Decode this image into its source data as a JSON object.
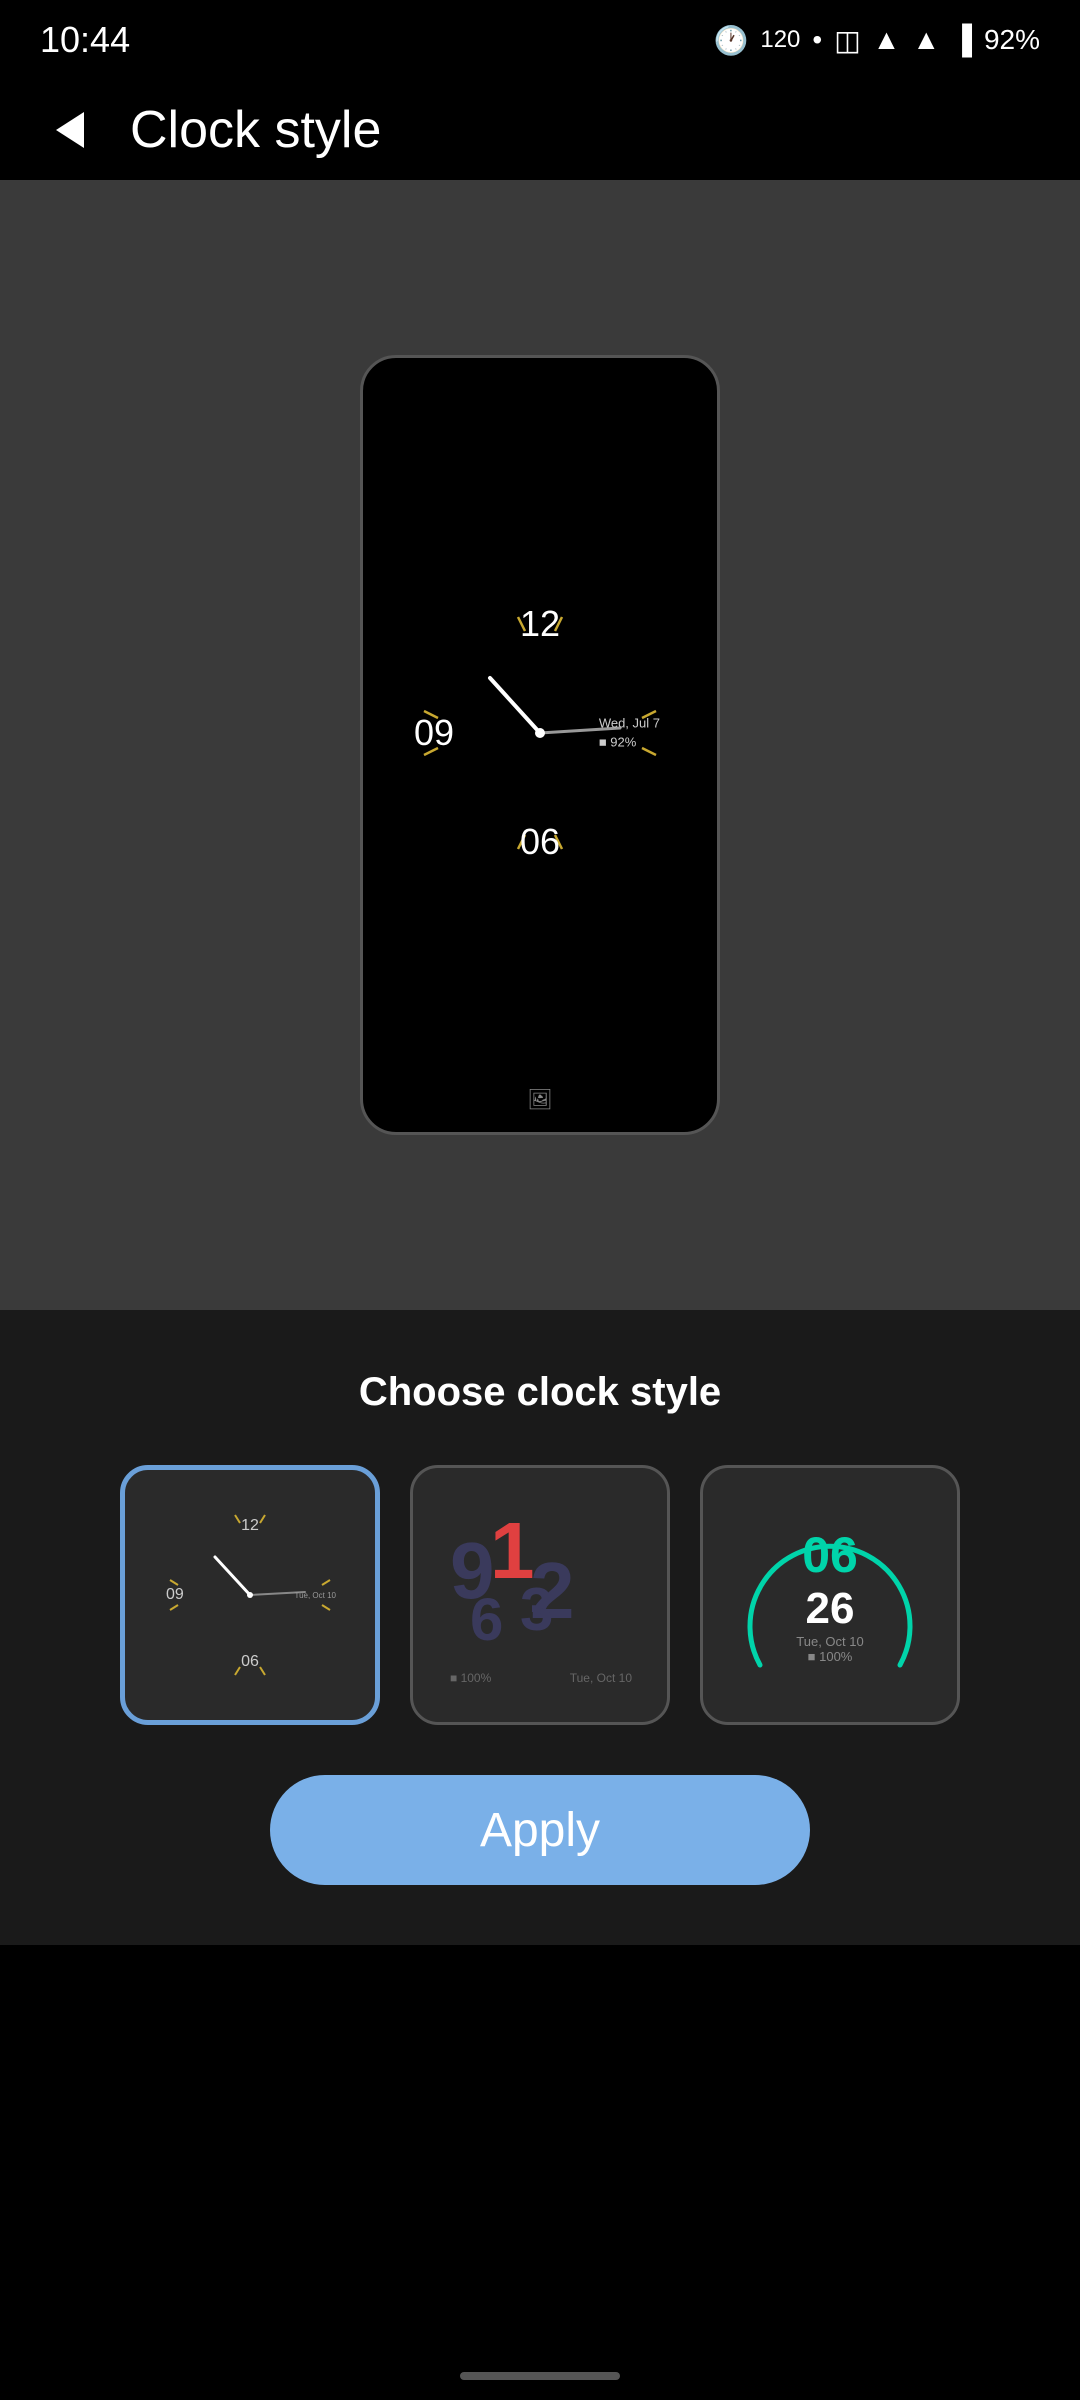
{
  "statusBar": {
    "time": "10:44",
    "batteryPercent": "92%"
  },
  "header": {
    "title": "Clock style",
    "backLabel": "Back"
  },
  "clockPreview": {
    "hour12": "12",
    "hour9": "09",
    "hour6": "06",
    "infoLine1": "Wed, Jul 7",
    "infoLine2": "■ 92%"
  },
  "clockStyles": {
    "sectionTitle": "Choose clock style",
    "styles": [
      {
        "id": "analog",
        "label": "Analog style",
        "selected": true
      },
      {
        "id": "digital-overlap",
        "label": "Overlapping numbers",
        "selected": false
      },
      {
        "id": "digital-arc",
        "label": "Arc digital",
        "selected": false
      }
    ]
  },
  "applyButton": {
    "label": "Apply"
  },
  "thumb2": {
    "mainText": "12",
    "subText": "963",
    "accentText": "1",
    "dateInfo": "Tue, Oct 10",
    "batteryInfo": "■ 100%"
  },
  "thumb3": {
    "hours": "06",
    "minutes": "26",
    "dateInfo": "Tue, Oct 10",
    "batteryInfo": "■ 100%"
  }
}
